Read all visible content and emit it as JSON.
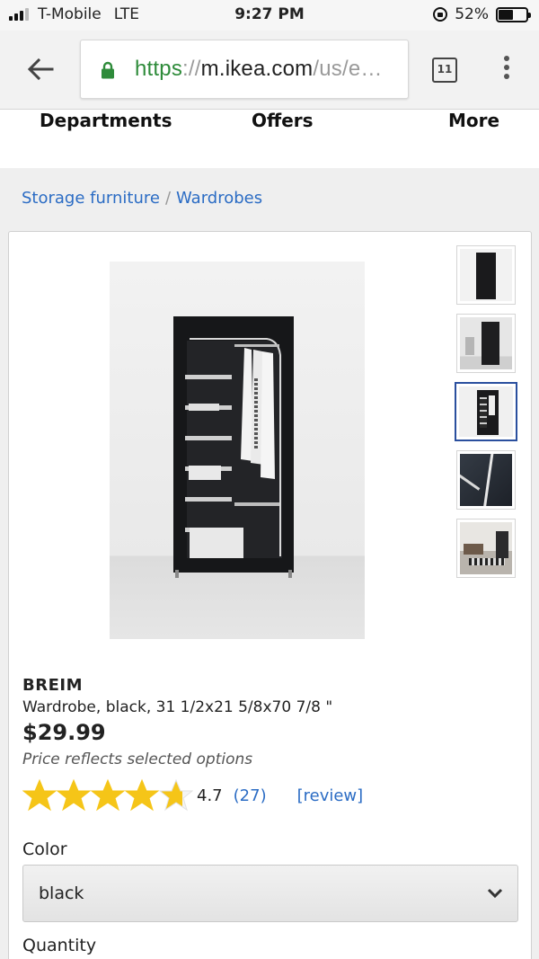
{
  "status_bar": {
    "carrier": "T-Mobile",
    "network": "LTE",
    "time": "9:27 PM",
    "battery": "52%",
    "battery_level": 0.52
  },
  "browser": {
    "url_scheme": "https",
    "url_sep": "://",
    "url_host": "m.ikea.com",
    "url_path": "/us/e…",
    "tab_count": "11"
  },
  "site_nav": {
    "items": [
      "Departments",
      "Offers",
      "More"
    ]
  },
  "breadcrumb": {
    "items": [
      "Storage furniture",
      "Wardrobes"
    ],
    "separator": "/"
  },
  "product": {
    "name": "BREIM",
    "description": "Wardrobe, black, 31 1/2x21 5/8x70 7/8 \"",
    "price": "$29.99",
    "price_note": "Price reflects selected options",
    "rating_value": "4.7",
    "rating_stars": 4.7,
    "review_count": "(27)",
    "review_link": "[review]",
    "thumbnails": [
      "wardrobe-front",
      "wardrobe-room",
      "wardrobe-open",
      "wardrobe-zipper",
      "living-room"
    ],
    "active_thumbnail": 2
  },
  "options": {
    "color_label": "Color",
    "color_value": "black",
    "quantity_label": "Quantity"
  },
  "colors": {
    "link": "#2b6cc4",
    "secure": "#2e8b3a",
    "star": "#f5c518",
    "active_thumb_border": "#2a4f9e"
  }
}
